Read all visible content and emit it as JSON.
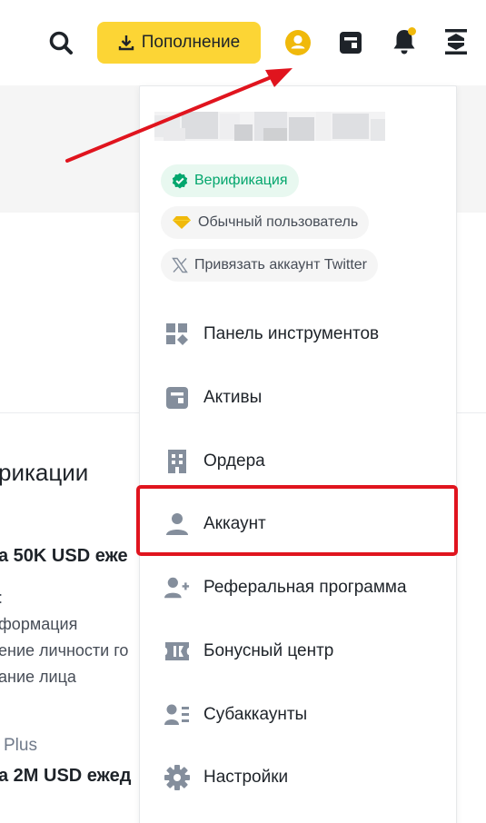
{
  "header": {
    "deposit_label": "Пополнение",
    "accent_color": "#fcd535",
    "icons": [
      "search-icon",
      "download-icon",
      "user-avatar-icon",
      "wallet-icon",
      "bell-icon",
      "transfer-icon"
    ]
  },
  "background_page": {
    "heading_fragment": "рикации",
    "limit1_fragment": "а 50K USD еже",
    "colon_fragment": ":",
    "list_fragments": [
      "формация",
      "ение личности го",
      "ание лица"
    ],
    "plus_fragment": "Plus",
    "limit2_fragment": "а 2M USD ежед"
  },
  "dropdown": {
    "chips": {
      "verification": "Верификация",
      "user_level": "Обычный пользователь",
      "twitter": "Привязать аккаунт Twitter"
    },
    "menu": [
      {
        "label": "Панель инструментов",
        "icon": "dashboard-icon"
      },
      {
        "label": "Активы",
        "icon": "wallet-icon"
      },
      {
        "label": "Ордера",
        "icon": "orders-icon"
      },
      {
        "label": "Аккаунт",
        "icon": "person-icon"
      },
      {
        "label": "Реферальная программа",
        "icon": "add-person-icon"
      },
      {
        "label": "Бонусный центр",
        "icon": "ticket-icon"
      },
      {
        "label": "Субаккаунты",
        "icon": "sub-accounts-icon"
      },
      {
        "label": "Настройки",
        "icon": "settings-gear-icon"
      }
    ]
  },
  "annotations": {
    "highlight_color": "#e0141e",
    "arrow_color": "#e0141e"
  }
}
